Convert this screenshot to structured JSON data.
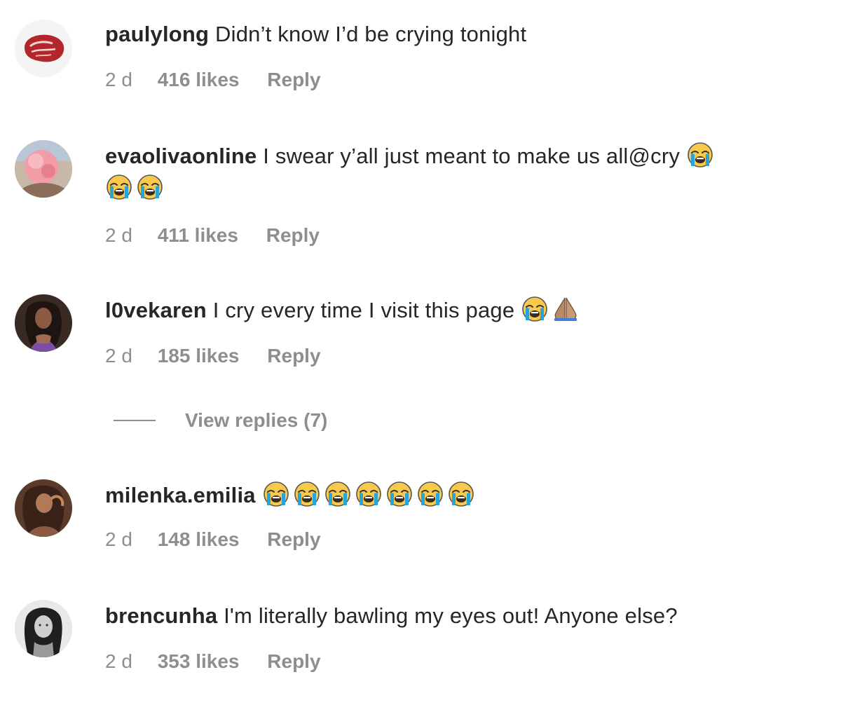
{
  "comments": [
    {
      "username": "paulylong",
      "text": "Didn’t know I’d be crying tonight",
      "line2": "",
      "age": "2 d",
      "likes": "416 likes",
      "reply": "Reply",
      "avatar_icon": "steak-avatar"
    },
    {
      "username": "evaolivaonline",
      "text": "I swear y’all just meant to make us all@cry",
      "line2": "",
      "age": "2 d",
      "likes": "411 likes",
      "reply": "Reply",
      "avatar_icon": "pink-flower-avatar"
    },
    {
      "username": "l0vekaren",
      "text": "I cry every time I visit this page",
      "line2": "",
      "age": "2 d",
      "likes": "185 likes",
      "reply": "Reply",
      "avatar_icon": "woman-portrait-avatar"
    },
    {
      "username": "milenka.emilia",
      "text": "",
      "line2": "",
      "age": "2 d",
      "likes": "148 likes",
      "reply": "Reply",
      "avatar_icon": "woman-portrait-avatar"
    },
    {
      "username": "brencunha",
      "text": "I'm literally bawling my eyes out! Anyone else?",
      "line2": "",
      "age": "2 d",
      "likes": "353 likes",
      "reply": "Reply",
      "avatar_icon": "bw-portrait-avatar"
    }
  ],
  "view_replies": {
    "label": "View replies (7)"
  },
  "emoji_names": {
    "crying": "loudly-crying-face-icon",
    "pray": "folded-hands-icon"
  },
  "colors": {
    "text": "#262626",
    "secondary": "#8e8e8e",
    "background": "#ffffff"
  }
}
